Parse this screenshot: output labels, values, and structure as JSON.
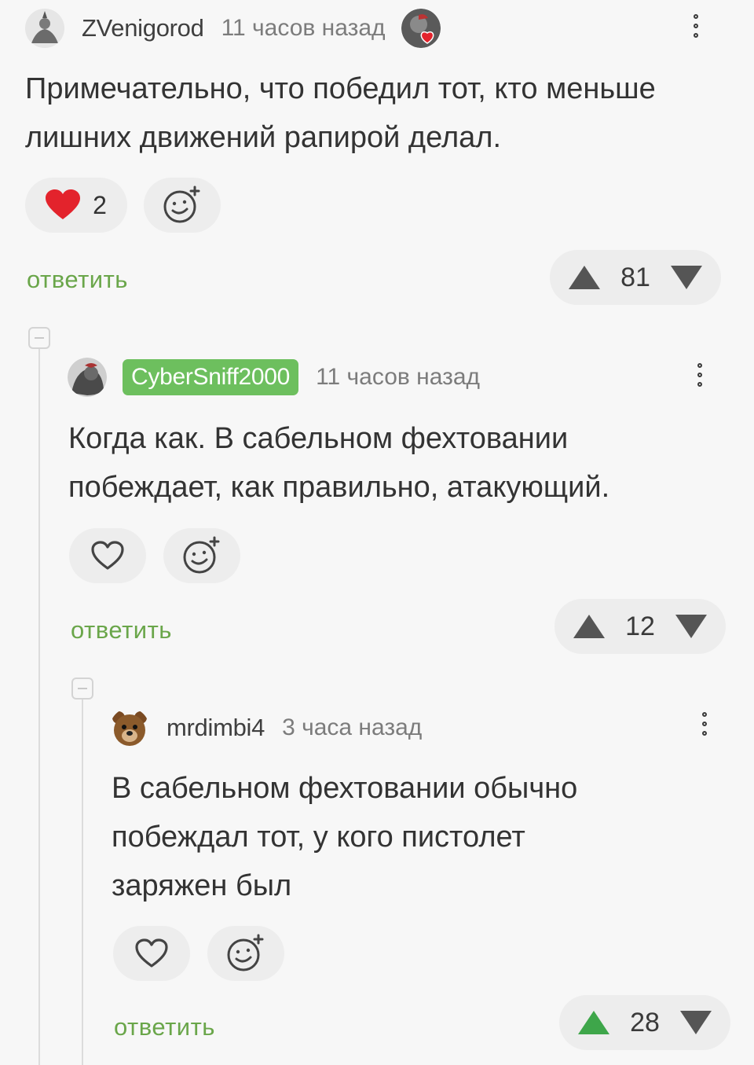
{
  "comments": [
    {
      "username": "ZVenigorod",
      "time": "11 часов назад",
      "text_lines": [
        "Примечательно, что победил тот, кто меньше",
        "лишних движений рапирой делал."
      ],
      "likes": "2",
      "reply_label": "ответить",
      "score": "81"
    },
    {
      "username": "CyberSniff2000",
      "time": "11 часов назад",
      "text_lines": [
        "Когда как. В сабельном фехтовании",
        "побеждает, как правильно, атакующий."
      ],
      "reply_label": "ответить",
      "score": "12"
    },
    {
      "username": "mrdimbi4",
      "time": "3 часа назад",
      "text_lines": [
        "В сабельном фехтовании обычно",
        "побеждал тот, у кого пистолет",
        "заряжен был"
      ],
      "reply_label": "ответить",
      "score": "28"
    }
  ],
  "colors": {
    "accent_green": "#6aa64a",
    "op_badge": "#6dbf5e",
    "heart_red": "#e3232c",
    "upvote_active": "#3ea64a"
  },
  "icons": [
    "heart-icon",
    "add-reaction-icon",
    "upvote-icon",
    "downvote-icon",
    "more-icon",
    "collapse-icon"
  ]
}
